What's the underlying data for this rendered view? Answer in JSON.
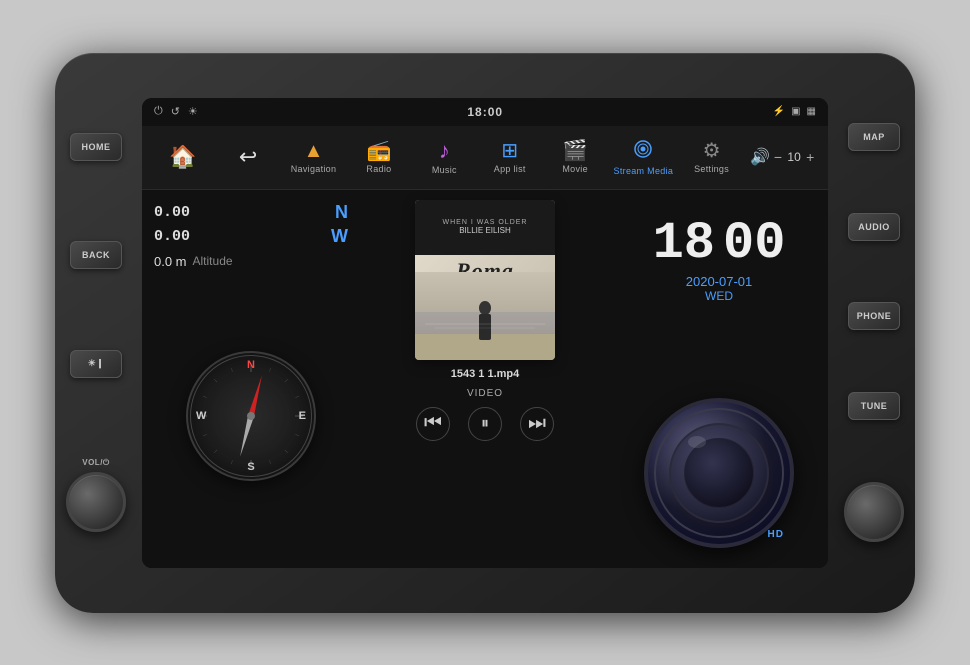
{
  "unit": {
    "status_bar": {
      "time": "18:00",
      "left_icons": [
        "⏻",
        "↺",
        "☀"
      ],
      "right_icons": [
        "⚡",
        "□",
        "□"
      ]
    },
    "nav_items": [
      {
        "id": "home",
        "icon": "🏠",
        "label": "",
        "icon_class": "icon-home"
      },
      {
        "id": "back",
        "icon": "↩",
        "label": "",
        "icon_class": "icon-back"
      },
      {
        "id": "navigation",
        "icon": "▲",
        "label": "Navigation",
        "icon_class": "icon-nav"
      },
      {
        "id": "radio",
        "icon": "📻",
        "label": "Radio",
        "icon_class": "icon-radio"
      },
      {
        "id": "music",
        "icon": "♪",
        "label": "Music",
        "icon_class": "icon-music"
      },
      {
        "id": "applist",
        "icon": "⊞",
        "label": "App list",
        "icon_class": "icon-apps"
      },
      {
        "id": "movie",
        "icon": "🎬",
        "label": "Movie",
        "icon_class": "icon-movie"
      },
      {
        "id": "stream",
        "icon": "▶",
        "label": "Stream Media",
        "icon_class": "icon-stream",
        "active": true
      },
      {
        "id": "settings",
        "icon": "⚙",
        "label": "Settings",
        "icon_class": "icon-settings"
      }
    ],
    "volume": {
      "icon": "🔊",
      "minus": "−",
      "value": "10",
      "plus": "+"
    },
    "left_panel": {
      "coord1": "0.00",
      "dir1": "N",
      "coord2": "0.00",
      "dir2": "W",
      "altitude_value": "0.0 m",
      "altitude_label": "Altitude"
    },
    "center_panel": {
      "song_title": "WHEN I WAS OLDER",
      "artist": "BILLIE EILISH",
      "album_title": "Roma",
      "filename": "1543 1 1.mp4",
      "media_type": "VIDEO",
      "controls": {
        "prev": "⏮",
        "play_pause": "⏸",
        "next": "⏭"
      }
    },
    "right_panel": {
      "hour": "18",
      "minute": "00",
      "date": "2020-07-01",
      "day": "WED"
    },
    "side_buttons": {
      "left": [
        "HOME",
        "BACK",
        ""
      ],
      "right": [
        "MAP",
        "AUDIO",
        "PHONE",
        "TUNE"
      ]
    },
    "hd_badge": "HD"
  }
}
